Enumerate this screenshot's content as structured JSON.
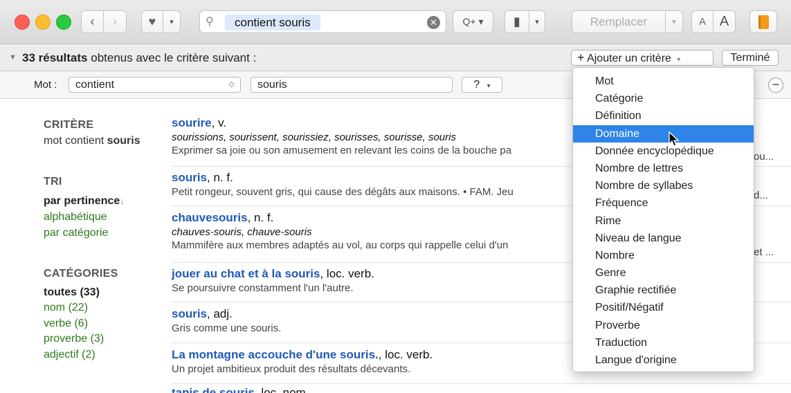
{
  "toolbar": {
    "search_text": "contient souris",
    "replace_label": "Remplacer",
    "font_small": "A",
    "font_large": "A"
  },
  "criteria": {
    "summary_count": "33 résultats",
    "summary_rest": "obtenus avec le critère suivant :",
    "add_label": "Ajouter un critère",
    "done_label": "Terminé"
  },
  "filter": {
    "label": "Mot :",
    "operator": "contient",
    "value": "souris",
    "extra": "?"
  },
  "sidebar": {
    "criteria_heading": "CRITÈRE",
    "criteria_pre": "mot contient",
    "criteria_word": "souris",
    "sort_heading": "TRI",
    "sort_active": "par pertinence",
    "sort_opt1": "alphabétique",
    "sort_opt2": "par catégorie",
    "cat_heading": "CATÉGORIES",
    "cat_all": "toutes (33)",
    "cat_noun": "nom (22)",
    "cat_verb": "verbe (6)",
    "cat_prov": "proverbe (3)",
    "cat_adj": "adjectif (2)"
  },
  "results": [
    {
      "word": "sourire",
      "pos": ", v.",
      "line1": "sourissions, sourissent, sourissiez, sourisses, sourisse, souris",
      "line2": "Exprimer sa joie ou son amusement en relevant les coins de la bouche pa",
      "tail": "ou..."
    },
    {
      "word": "souris",
      "pos": ", n. f.",
      "line1": "Petit rongeur, souvent gris, qui cause des dégâts aux maisons. • FAM. Jeu",
      "tail": "d..."
    },
    {
      "word": "chauvesouris",
      "pos": ", n. f.",
      "line1": "chauves-souris, chauve-souris",
      "line2": "Mammifère aux membres adaptés au vol, au corps qui rappelle celui d'un",
      "tail": "et ..."
    },
    {
      "word": "jouer au chat et à la souris",
      "pos": ", loc. verb.",
      "line1": "Se poursuivre constamment l'un l'autre."
    },
    {
      "word": "souris",
      "pos": ", adj.",
      "line1": "Gris comme une souris."
    },
    {
      "word": "La montagne accouche d'une souris.",
      "pos": ", loc. verb.",
      "line1": "Un projet ambitieux produit des résultats décevants."
    },
    {
      "word": "tapis de souris",
      "pos": ", loc. nom."
    }
  ],
  "menu": [
    "Mot",
    "Catégorie",
    "Définition",
    "Domaine",
    "Donnée encyclopédique",
    "Nombre de lettres",
    "Nombre de syllabes",
    "Fréquence",
    "Rime",
    "Niveau de langue",
    "Nombre",
    "Genre",
    "Graphie rectifiée",
    "Positif/Négatif",
    "Proverbe",
    "Traduction",
    "Langue d'origine"
  ]
}
